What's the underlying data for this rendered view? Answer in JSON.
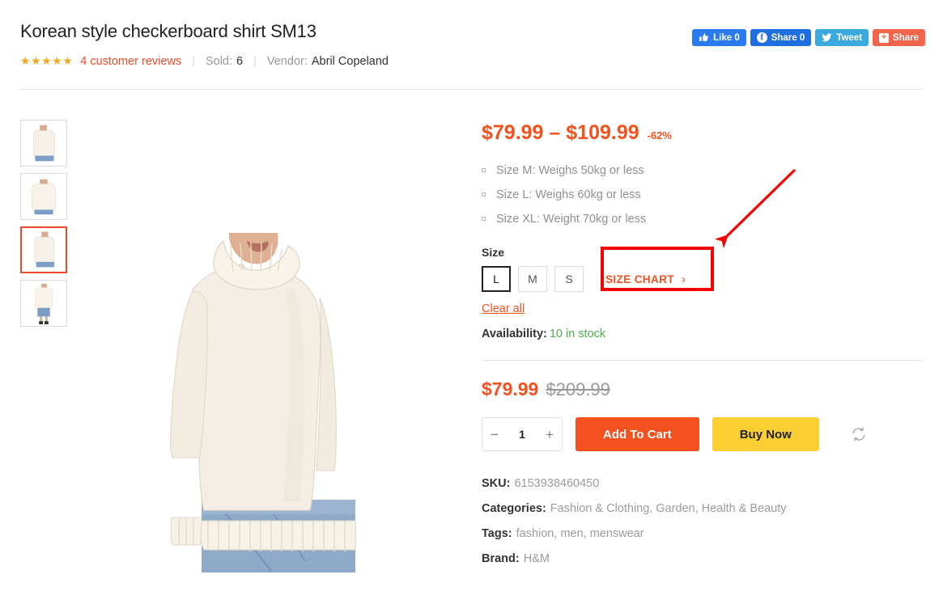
{
  "header": {
    "title": "Korean style checkerboard shirt SM13",
    "rating_stars": "★★★★★",
    "reviews_link": "4 customer reviews",
    "sold_label": "Sold:",
    "sold_count": "6",
    "vendor_label": "Vendor:",
    "vendor_name": "Abril Copeland",
    "separator": "|"
  },
  "social": {
    "buttons": [
      {
        "name": "facebook-like",
        "label": "Like 0",
        "icon": "thumbs-up-icon",
        "color": "#2a7af0"
      },
      {
        "name": "facebook-share",
        "label": "Share 0",
        "icon": "facebook-icon",
        "color": "#1f6fe0"
      },
      {
        "name": "twitter-tweet",
        "label": "Tweet",
        "icon": "twitter-bird-icon",
        "color": "#3aa9e0"
      },
      {
        "name": "generic-share",
        "label": "Share",
        "icon": "plus-icon",
        "color": "#f2654a"
      }
    ]
  },
  "gallery": {
    "thumbnails": [
      {
        "alt": "sweater-side-view",
        "active": false
      },
      {
        "alt": "sweater-back-view",
        "active": false
      },
      {
        "alt": "sweater-front-view",
        "active": true
      },
      {
        "alt": "sweater-full-body-view",
        "active": false
      }
    ],
    "main_alt": "woman-wearing-cream-turtleneck-sweater"
  },
  "summary": {
    "price_range": "$79.99 – $109.99",
    "discount": "-62%",
    "features": [
      "Size M: Weighs 50kg or less",
      "Size L: Weighs 60kg or less",
      "Size XL: Weight 70kg or less"
    ],
    "size_label": "Size",
    "sizes": [
      {
        "label": "L",
        "selected": true
      },
      {
        "label": "M",
        "selected": false
      },
      {
        "label": "S",
        "selected": false
      }
    ],
    "size_chart_label": "SIZE CHART",
    "size_chart_chevron": "›",
    "clear_all": "Clear all",
    "availability_label": "Availability:",
    "availability_value": "10 in stock",
    "sale_price": "$79.99",
    "old_price": "$209.99",
    "quantity": "1",
    "qty_minus": "−",
    "qty_plus": "+",
    "add_to_cart": "Add To Cart",
    "buy_now": "Buy Now",
    "compare_icon": "compare-refresh-icon"
  },
  "product_meta": {
    "sku_label": "SKU:",
    "sku_value": "6153938460450",
    "categories_label": "Categories:",
    "categories": "Fashion & Clothing, Garden, Health & Beauty",
    "tags_label": "Tags:",
    "tags": "fashion, men, menswear",
    "brand_label": "Brand:",
    "brand": "H&M"
  },
  "annotation": {
    "box_target": "size-chart-link",
    "arrow_color": "#f70000",
    "box_color": "#f70000"
  },
  "colors": {
    "accent": "#f4511e",
    "buy_now": "#fbcf33",
    "stars": "#f5a623",
    "in_stock": "#4caf50",
    "annotation": "#f70000"
  }
}
